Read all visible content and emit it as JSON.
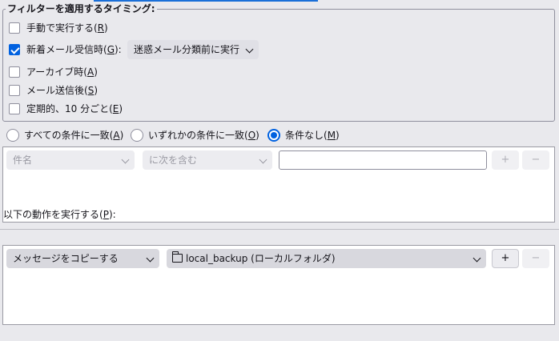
{
  "timing": {
    "legend": "フィルターを適用するタイミング:",
    "options": [
      {
        "pre": "手動で実行する(",
        "key": "R",
        "post": ")",
        "checked": false
      },
      {
        "pre": "新着メール受信時(",
        "key": "G",
        "post": "):",
        "checked": true
      },
      {
        "pre": "アーカイブ時(",
        "key": "A",
        "post": ")",
        "checked": false
      },
      {
        "pre": "メール送信後(",
        "key": "S",
        "post": ")",
        "checked": false
      },
      {
        "pre": "定期的、10 分ごと(",
        "key": "E",
        "post": ")",
        "checked": false
      }
    ],
    "new_mail_select": "迷惑メール分類前に実行"
  },
  "match": {
    "options": [
      {
        "pre": "すべての条件に一致(",
        "key": "A",
        "post": ")",
        "selected": false
      },
      {
        "pre": "いずれかの条件に一致(",
        "key": "O",
        "post": ")",
        "selected": false
      },
      {
        "pre": "条件なし(",
        "key": "M",
        "post": ")",
        "selected": true
      }
    ]
  },
  "rule": {
    "field_select": "件名",
    "operator_select": "に次を含む",
    "value": "",
    "add_label": "+",
    "remove_label": "−"
  },
  "actions": {
    "label_pre": "以下の動作を実行する(",
    "label_key": "P",
    "label_post": "):",
    "action_select": "メッセージをコピーする",
    "folder_select": "local_backup (ローカルフォルダ)",
    "add_label": "+",
    "remove_label": "−"
  },
  "colors": {
    "accent": "#0061e0",
    "background": "#e9e9ed"
  }
}
